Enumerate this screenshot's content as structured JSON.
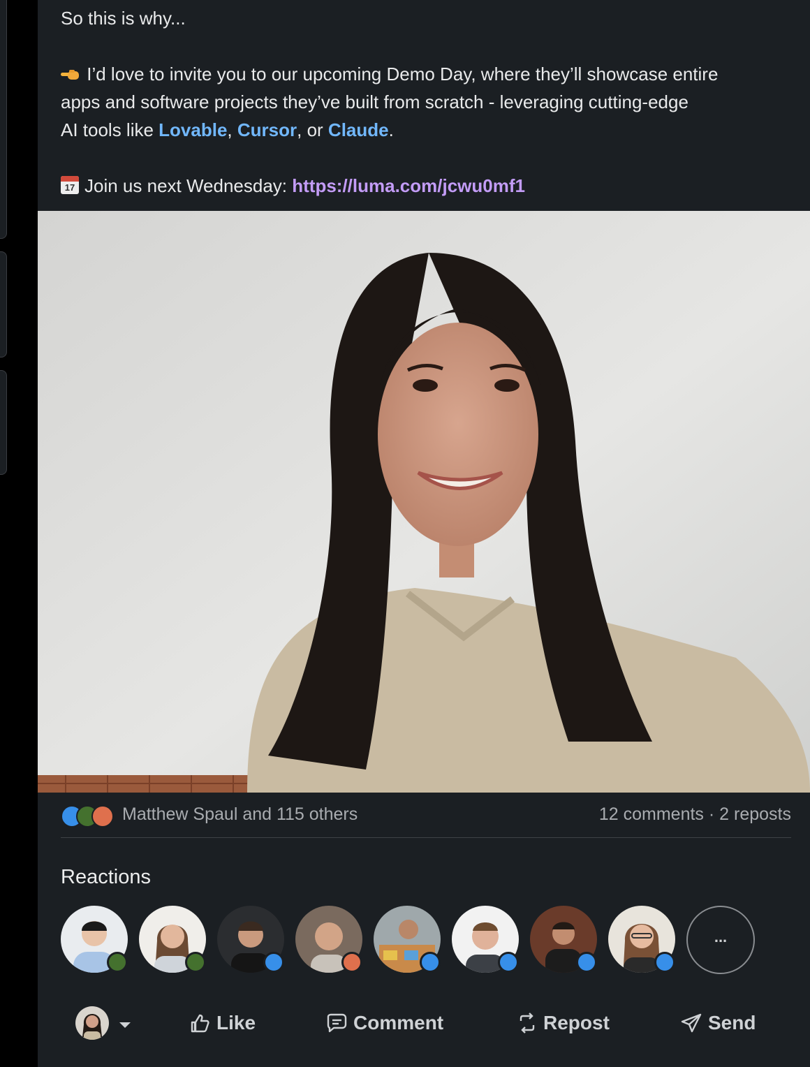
{
  "post": {
    "line_intro": "So this is why...",
    "invite_pre": "I’d love to invite you to our upcoming Demo Day, where they’ll showcase entire",
    "invite_mid": "apps and software projects they’ve built from scratch - leveraging cutting-edge",
    "invite_tools_pre": "AI tools like ",
    "tool_1": "Lovable",
    "sep_1": ", ",
    "tool_2": "Cursor",
    "sep_2": ", or ",
    "tool_3": "Claude",
    "end_period": ".",
    "calendar_day": "17",
    "join_text": "Join us next Wednesday: ",
    "join_link": "https://luma.com/jcwu0mf1"
  },
  "stats": {
    "reaction_icons": [
      "like-icon",
      "celebrate-icon",
      "love-icon"
    ],
    "likers": "Matthew Spaul and 115 others",
    "counts": "12 comments · 2 reposts"
  },
  "reactions": {
    "title": "Reactions",
    "more_label": "...",
    "people": [
      {
        "badge": "celebrate-icon"
      },
      {
        "badge": "celebrate-icon"
      },
      {
        "badge": "like-icon"
      },
      {
        "badge": "love-icon"
      },
      {
        "badge": "like-icon"
      },
      {
        "badge": "like-icon"
      },
      {
        "badge": "like-icon"
      },
      {
        "badge": "like-icon"
      }
    ]
  },
  "actions": {
    "like": "Like",
    "comment": "Comment",
    "repost": "Repost",
    "send": "Send"
  },
  "colors": {
    "background": "#1b1f23",
    "link_blue": "#71b7fb",
    "link_purple": "#c39cf6",
    "like_blue": "#378fe9",
    "celebrate_green": "#44712e",
    "love_red": "#df704d"
  }
}
